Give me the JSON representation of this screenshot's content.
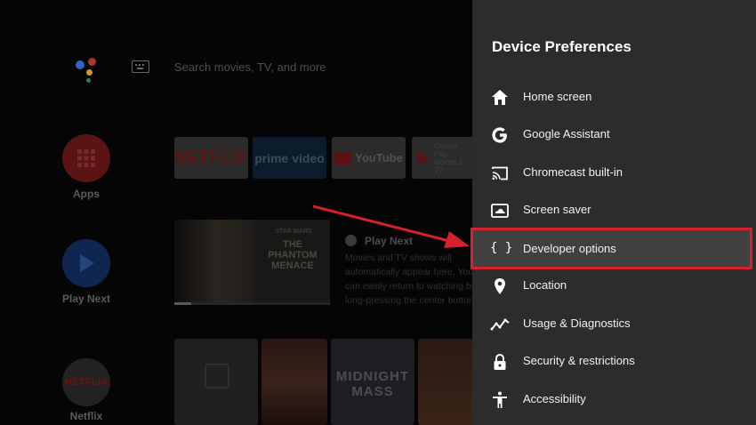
{
  "search": {
    "placeholder_text": "Search movies, TV, and more"
  },
  "rail": {
    "apps_label": "Apps",
    "play_next_label": "Play Next",
    "netflix_label": "Netflix",
    "netflix_logo_text": "NETFLIX"
  },
  "apps_row": {
    "tiles": [
      {
        "text": "NETFLIX"
      },
      {
        "text": "prime video"
      },
      {
        "text": "YouTube"
      },
      {
        "text": "Google Play Movies & TV"
      }
    ]
  },
  "play_next": {
    "thumb_title_top": "STAR WARS",
    "thumb_title": "THE PHANTOM MENACE",
    "title": "Play Next",
    "description": "Movies and TV shows will automatically appear here. You can easily return to watching by long-pressing the center button.",
    "progress_percent": 11
  },
  "bottom_row": {
    "midnight_mass_line1": "MIDNIGHT",
    "midnight_mass_line2": "MASS"
  },
  "panel": {
    "title": "Device Preferences",
    "items": [
      {
        "label": "Home screen",
        "icon": "home-icon"
      },
      {
        "label": "Google Assistant",
        "icon": "google-icon"
      },
      {
        "label": "Chromecast built-in",
        "icon": "cast-icon"
      },
      {
        "label": "Screen saver",
        "icon": "screen-saver-icon"
      },
      {
        "label": "Developer options",
        "icon": "braces-icon",
        "icon_text": "{ }"
      },
      {
        "label": "Location",
        "icon": "location-pin-icon"
      },
      {
        "label": "Usage & Diagnostics",
        "icon": "usage-trend-icon"
      },
      {
        "label": "Security & restrictions",
        "icon": "lock-icon"
      },
      {
        "label": "Accessibility",
        "icon": "accessibility-icon"
      }
    ]
  },
  "colors": {
    "panel_bg": "#2c2c2c",
    "highlight_bg": "#404040",
    "annotation_red": "#d7202a",
    "netflix_red": "#e50914"
  }
}
